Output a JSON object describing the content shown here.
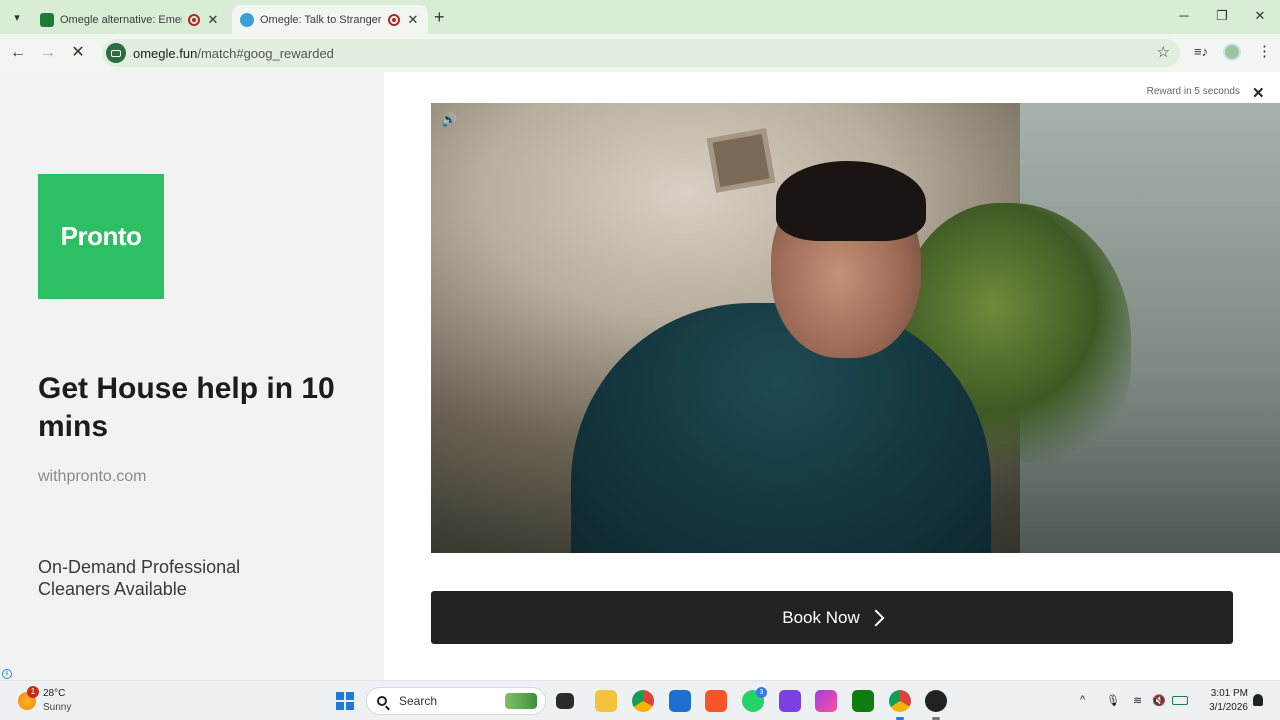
{
  "browser": {
    "tabs": [
      {
        "title": "Omegle alternative: Emerald",
        "active": false,
        "favicon_color": "#1e7b34"
      },
      {
        "title": "Omegle: Talk to Strangers w",
        "active": true,
        "favicon_color": "#3aa0d8"
      }
    ],
    "new_tab_symbol": "+",
    "window_controls": {
      "minimize": "─",
      "maximize": "❐",
      "close": "✕"
    },
    "nav": {
      "back": "←",
      "forward": "→",
      "reload": "✕"
    },
    "url_host": "omegle.fun",
    "url_path": "/match#goog_rewarded",
    "bookmark_icon": "☆",
    "media_icon": "≡♪",
    "menu_icon": "⋮"
  },
  "ad": {
    "brand_logo_text": "Pronto",
    "headline": "Get House help in 10 mins",
    "domain": "withpronto.com",
    "description": "On-Demand Professional Cleaners Available",
    "reward_text": "Reward in 5 seconds",
    "close_symbol": "✕",
    "mute_symbol": "🔊",
    "cta_label": "Book Now",
    "info_symbol": "i",
    "brand_color": "#2dbf63"
  },
  "taskbar": {
    "weather_badge": "1",
    "temperature": "28°C",
    "condition": "Sunny",
    "search_placeholder": "Search",
    "whatsapp_badge": "3",
    "time": "3:01 PM",
    "date": "3/1/2026",
    "tray_chevron": "^",
    "mic_icon": "🎙",
    "wifi_icon": "≋",
    "volume_icon": "🔇"
  }
}
